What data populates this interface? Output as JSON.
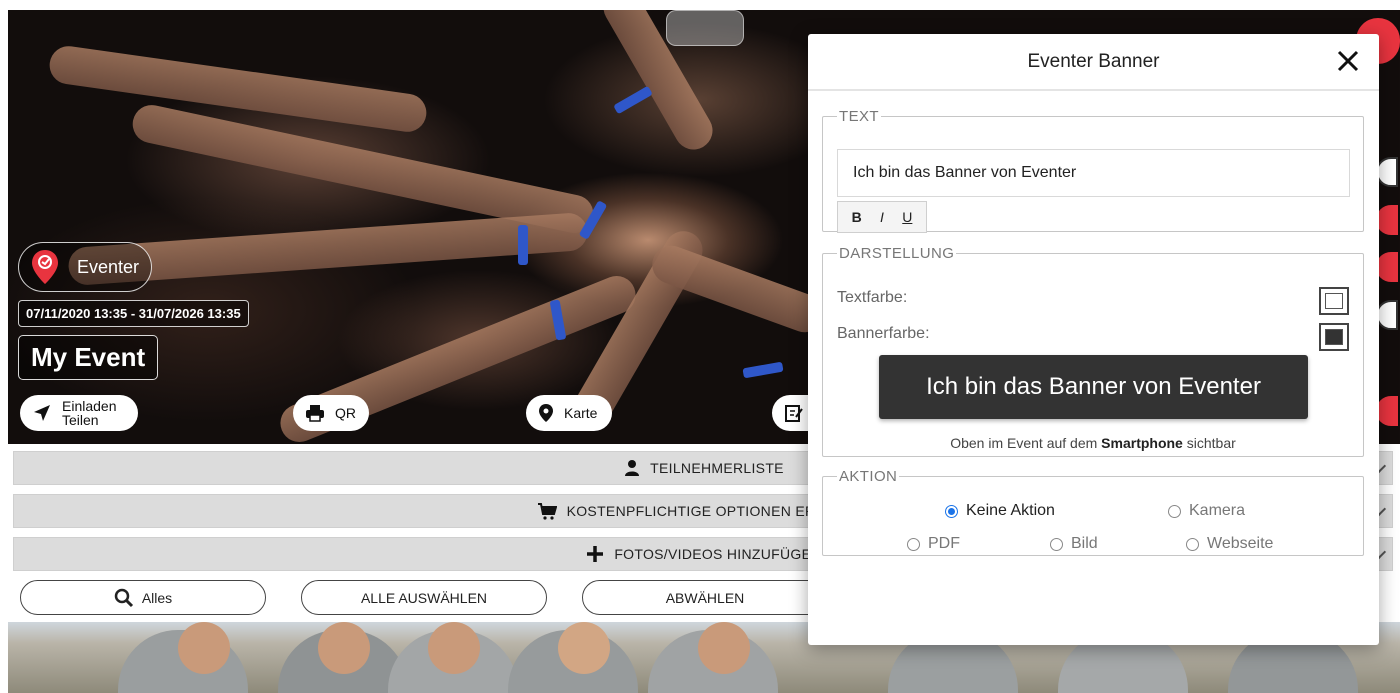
{
  "event": {
    "brand": "Eventer",
    "date_range": "07/11/2020 13:35 - 31/07/2026 13:35",
    "title": "My Event"
  },
  "hero_buttons": {
    "invite_line1": "Einladen",
    "invite_line2": "Teilen",
    "qr": "QR",
    "map": "Karte"
  },
  "bars": {
    "participants": "TEILNEHMERLISTE",
    "paid_options": "KOSTENPFLICHTIGE OPTIONEN ERHALTEN",
    "add_media": "FOTOS/VIDEOS HINZUFÜGEN"
  },
  "filters": {
    "all": "Alles",
    "select_all": "ALLE AUSWÄHLEN",
    "deselect": "ABWÄHLEN"
  },
  "modal": {
    "title": "Eventer Banner",
    "text_section": {
      "legend": "TEXT",
      "value": "Ich bin das Banner von Eventer",
      "bold": "B",
      "italic": "I",
      "underline": "U"
    },
    "display_section": {
      "legend": "DARSTELLUNG",
      "text_color_label": "Textfarbe:",
      "banner_color_label": "Bannerfarbe:",
      "text_color": "#ffffff",
      "banner_color": "#333333",
      "preview_text": "Ich bin das Banner von Eventer",
      "hint_prefix": "Oben im Event auf dem",
      "hint_strong": "Smartphone",
      "hint_suffix": "sichtbar"
    },
    "action_section": {
      "legend": "AKTION",
      "options": {
        "none": "Keine Aktion",
        "camera": "Kamera",
        "pdf": "PDF",
        "image": "Bild",
        "website": "Webseite"
      },
      "selected": "Keine Aktion"
    }
  },
  "colors": {
    "accent_red": "#e8343f",
    "radio_blue": "#1a73e8",
    "bar_gray": "#dcdcdc"
  }
}
